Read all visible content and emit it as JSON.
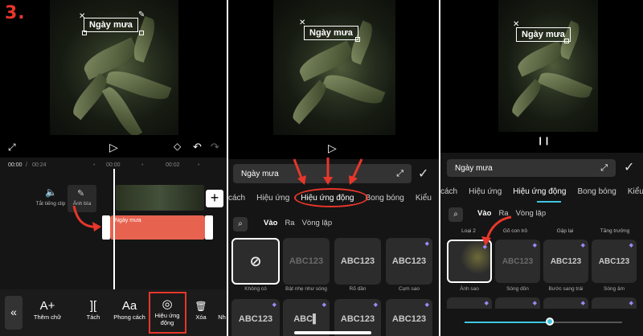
{
  "step_label": "3.",
  "caption_text": "Ngày mưa",
  "panel1": {
    "time_current": "00:00",
    "time_total": "00:24",
    "ruler": [
      "00:00",
      "00:02"
    ],
    "side_controls": [
      {
        "label": "Tắt tiếng clip",
        "icon": "speaker-icon"
      },
      {
        "label": "Ảnh bìa",
        "icon": "pencil-icon"
      }
    ],
    "caption_clip_label": "Ngày mưa",
    "toolbar": [
      {
        "label": "Thêm chữ",
        "icon": "A+"
      },
      {
        "label": "Tách",
        "icon": "]["
      },
      {
        "label": "Phong cách",
        "icon": "Aa"
      },
      {
        "label": "Hiệu ứng động",
        "icon": "◎"
      },
      {
        "label": "Xóa",
        "icon": "🗑"
      },
      {
        "label": "Nh",
        "icon": ""
      }
    ],
    "back_icon": "«"
  },
  "panel2": {
    "input_value": "Ngày mưa",
    "tabs": [
      "cách",
      "Hiệu ứng",
      "Hiệu ứng động",
      "Bong bóng",
      "Kiểu"
    ],
    "active_tab": "Hiệu ứng động",
    "subtabs": [
      "Vào",
      "Ra",
      "Vòng lặp"
    ],
    "active_subtab": "Vào",
    "tiles_row1": [
      {
        "label": "Không có",
        "text": "⊘"
      },
      {
        "label": "Bật nhẹ như sóng",
        "text": "ABC123"
      },
      {
        "label": "Rõ dần",
        "text": "ABC123"
      },
      {
        "label": "Cụm sao",
        "text": "ABC123"
      }
    ],
    "tiles_row2": [
      "ABC123",
      "ABC▌",
      "ABC123",
      "ABC123"
    ]
  },
  "panel3": {
    "input_value": "Ngày mưa",
    "tabs": [
      "cách",
      "Hiệu ứng",
      "Hiệu ứng động",
      "Bong bóng",
      "Kiểu"
    ],
    "active_tab": "Hiệu ứng động",
    "subtabs": [
      "Vào",
      "Ra",
      "Vòng lặp"
    ],
    "active_subtab": "Vào",
    "groups": [
      "Loại 2",
      "Gõ con trỏ",
      "Gập lại",
      "Tăng trưởng"
    ],
    "tiles": [
      {
        "label": "Ánh sao",
        "text": ""
      },
      {
        "label": "Sóng dồn",
        "text": "ABC123"
      },
      {
        "label": "Bước sang trái",
        "text": "ABC123"
      },
      {
        "label": "Sóng âm",
        "text": "ABC123"
      }
    ],
    "slider_value": 0.54,
    "pause_icon": "❙❙"
  },
  "colors": {
    "accent": "#3ec6e0",
    "highlight": "#e8362b",
    "caption_clip": "#e7634f"
  }
}
